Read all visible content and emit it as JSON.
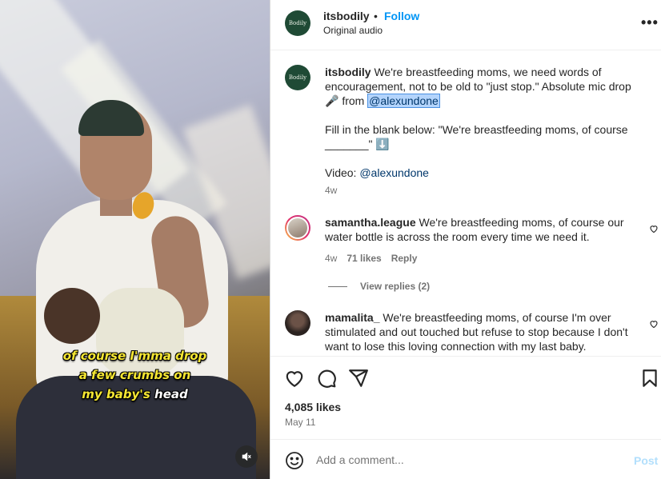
{
  "video": {
    "caption_lines": [
      {
        "yellow": "of course I'mma drop",
        "white": ""
      },
      {
        "yellow": "a few crumbs on",
        "white": ""
      },
      {
        "yellow": "my baby's ",
        "white": "head"
      }
    ],
    "mute_icon": "speaker-muted-icon"
  },
  "header": {
    "avatar_text": "Bodily",
    "username": "itsbodily",
    "separator": "•",
    "follow_label": "Follow",
    "audio": "Original audio",
    "more_icon": "•••"
  },
  "post": {
    "avatar_text": "Bodily",
    "username": "itsbodily",
    "text_1": " We're breastfeeding moms, we need words of encouragement, not to be old to \"just stop.\" Absolute mic drop 🎤 from ",
    "mention": "@alexundone",
    "text_2": "Fill in the blank below: \"We're breastfeeding moms, of course _______\" ⬇️",
    "video_label": "Video: ",
    "video_mention": "@alexundone",
    "age": "4w"
  },
  "comments": [
    {
      "username": "samantha.league",
      "text": " We're breastfeeding moms, of course our water bottle is across the room every time we need it.",
      "age": "4w",
      "likes": "71 likes",
      "reply": "Reply"
    },
    {
      "username": "mamalita_",
      "text": " We're breastfeeding moms, of course I'm over stimulated and out touched but refuse to stop because I don't want to lose this loving connection with my last baby."
    }
  ],
  "view_replies": "View replies (2)",
  "actions": {
    "likes": "4,085 likes",
    "date": "May 11"
  },
  "composer": {
    "placeholder": "Add a comment...",
    "post_label": "Post"
  },
  "colors": {
    "accent": "#0095f6",
    "brand_avatar": "#1f4a35",
    "caption_yellow": "#f6e733"
  }
}
